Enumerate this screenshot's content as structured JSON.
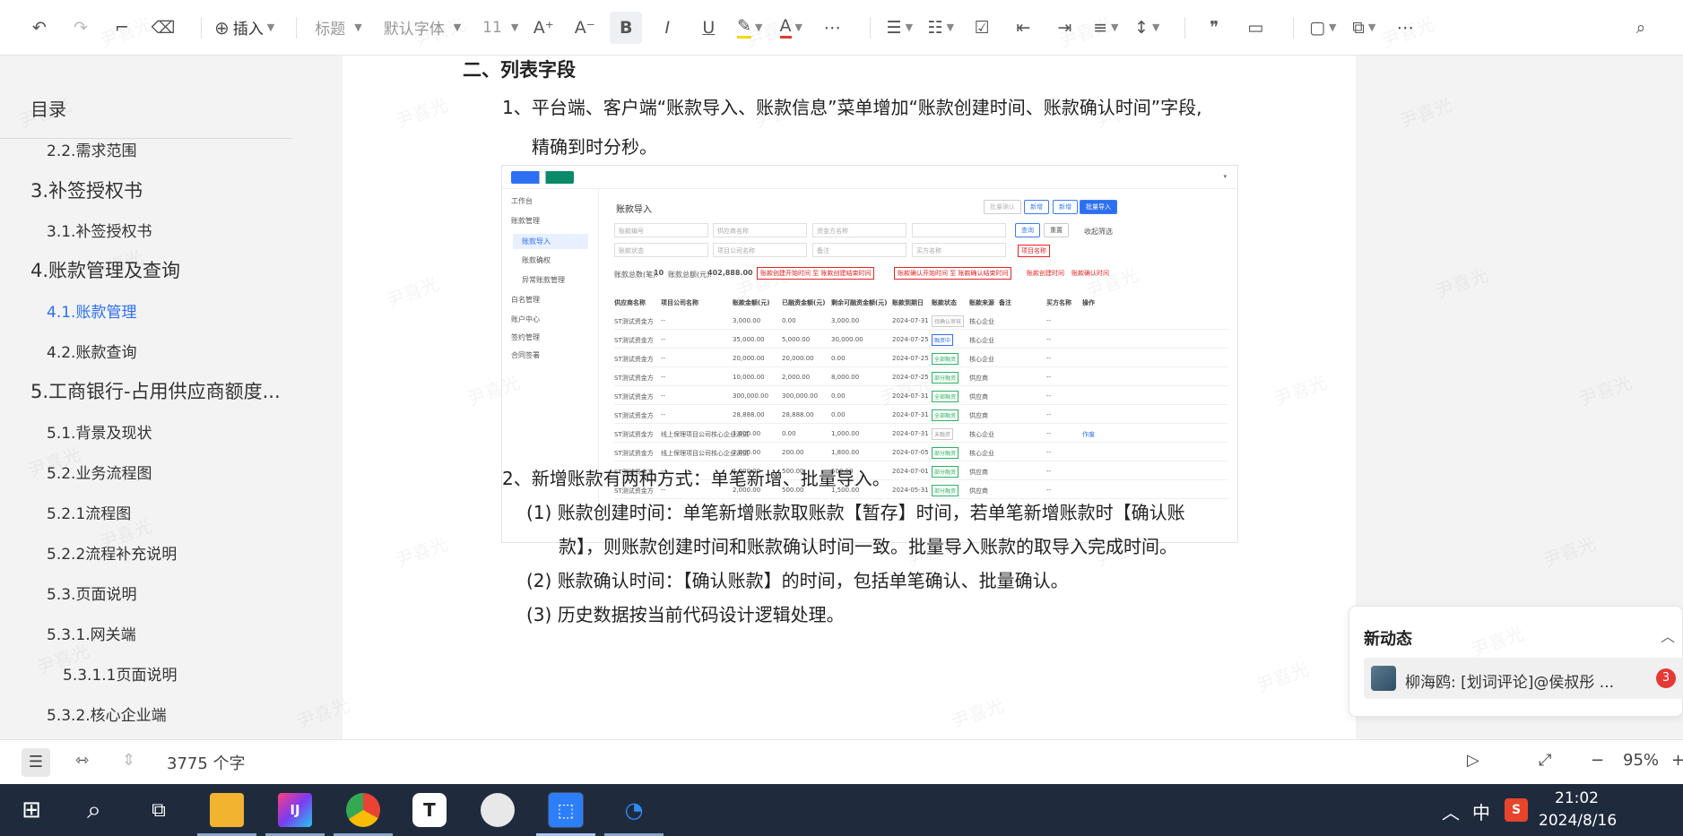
{
  "toolbar": {
    "insert_label": "插入",
    "heading_label": "标题",
    "font_label": "默认字体",
    "size_label": "11"
  },
  "toc": {
    "title": "目录",
    "items": [
      {
        "label": "2.2.需求范围",
        "level": 2
      },
      {
        "label": "3.补签授权书",
        "level": 1
      },
      {
        "label": "3.1.补签授权书",
        "level": 2
      },
      {
        "label": "4.账款管理及查询",
        "level": 1
      },
      {
        "label": "4.1.账款管理",
        "level": 2,
        "active": true
      },
      {
        "label": "4.2.账款查询",
        "level": 2
      },
      {
        "label": "5.工商银行-占用供应商额度...",
        "level": 1
      },
      {
        "label": "5.1.背景及现状",
        "level": 2
      },
      {
        "label": "5.2.业务流程图",
        "level": 2
      },
      {
        "label": "5.2.1流程图",
        "level": 3
      },
      {
        "label": "5.2.2流程补充说明",
        "level": 3
      },
      {
        "label": "5.3.页面说明",
        "level": 2
      },
      {
        "label": "5.3.1.网关端",
        "level": 3
      },
      {
        "label": "5.3.1.1页面说明",
        "level": 4
      },
      {
        "label": "5.3.2.核心企业端",
        "level": 3
      }
    ]
  },
  "doc": {
    "heading": "二、列表字段",
    "p1_line1": "1、平台端、客户端“账款导入、账款信息”菜单增加“账款创建时间、账款确认时间”字段,",
    "p1_line2": "精确到时分秒。",
    "p2": "2、新增账款有两种方式：单笔新增、批量导入。",
    "p2_1_line1": "(1) 账款创建时间：单笔新增账款取账款【暂存】时间，若单笔新增账款时【确认账",
    "p2_1_line2": "款】，则账款创建时间和账款确认时间一致。批量导入账款的取导入完成时间。",
    "p2_2": "(2) 账款确认时间：【确认账款】的时间，包括单笔确认、批量确认。",
    "p2_3": "(3) 历史数据按当前代码设计逻辑处理。"
  },
  "embedded": {
    "title": "账款导入",
    "nav": [
      "工作台",
      "账款管理",
      "账款导入",
      "账款确权",
      "异常账款管理",
      "白名管理",
      "账户中心",
      "签约管理",
      "合同签署"
    ],
    "buttons": [
      "批量确认",
      "新增",
      "批量导入"
    ],
    "filters": [
      "账款编号",
      "供应商名称",
      "资金方名称",
      "账款状态",
      "项目公司名称",
      "备注",
      "买方名称"
    ],
    "search": "查询",
    "reset": "重置",
    "collapse": "收起筛选",
    "red_labels": [
      "账款创建开始时间 至 账款创建结束时间",
      "账款确认开始时间 至 账款确认结束时间",
      "账款创建时间",
      "账款确认时间",
      "项目名称"
    ],
    "summary_count_label": "账款总数(笔):",
    "summary_count": "10",
    "summary_amount_label": "账款总额(元):",
    "summary_amount": "402,888.00",
    "columns": [
      "供应商名称",
      "项目公司名称",
      "账款金额(元)",
      "已融资金额(元)",
      "剩余可融资金额(元)",
      "账款到期日",
      "账款状态",
      "账款来源",
      "备注",
      "买方名称",
      "操作"
    ],
    "rows": [
      [
        "ST测试资金方",
        "--",
        "3,000.00",
        "0.00",
        "3,000.00",
        "2024-07-31",
        "待确认审核",
        "核心企业",
        "--"
      ],
      [
        "ST测试资金方",
        "--",
        "35,000.00",
        "5,000.00",
        "30,000.00",
        "2024-07-25",
        "融资中",
        "核心企业",
        "--"
      ],
      [
        "ST测试资金方",
        "--",
        "20,000.00",
        "20,000.00",
        "0.00",
        "2024-07-25",
        "全部融资",
        "核心企业",
        "--"
      ],
      [
        "ST测试资金方",
        "--",
        "10,000.00",
        "2,000.00",
        "8,000.00",
        "2024-07-25",
        "部分融资",
        "供应商",
        "--"
      ],
      [
        "ST测试资金方",
        "--",
        "300,000.00",
        "300,000.00",
        "0.00",
        "2024-07-31",
        "全部融资",
        "供应商",
        "--"
      ],
      [
        "ST测试资金方",
        "--",
        "28,888.00",
        "28,888.00",
        "0.00",
        "2024-07-31",
        "全部融资",
        "供应商",
        "--"
      ],
      [
        "ST测试资金方",
        "线上保理项目公司核心企业测试",
        "1,000.00",
        "0.00",
        "1,000.00",
        "2024-07-31",
        "未融资",
        "核心企业",
        "--"
      ],
      [
        "ST测试资金方",
        "线上保理项目公司核心企业测试",
        "2,000.00",
        "200.00",
        "1,800.00",
        "2024-07-05",
        "部分融资",
        "核心企业",
        "--"
      ],
      [
        "ST测试资金方",
        "--",
        "1,000.00",
        "500.00",
        "500.00",
        "2024-07-01",
        "部分融资",
        "供应商",
        "--"
      ],
      [
        "ST测试资金方",
        "--",
        "2,000.00",
        "500.00",
        "1,500.00",
        "2024-05-31",
        "部分融资",
        "供应商",
        "--"
      ]
    ],
    "op_link": "作废"
  },
  "notify": {
    "title": "新动态",
    "text": "柳海鸥: [划词评论]@侯叔彤 ...",
    "badge": "3"
  },
  "status": {
    "word_count": "3775 个字",
    "zoom": "95%"
  },
  "taskbar": {
    "ime": "中",
    "time": "21:02",
    "date": "2024/8/16"
  },
  "watermark": "尹喜光"
}
